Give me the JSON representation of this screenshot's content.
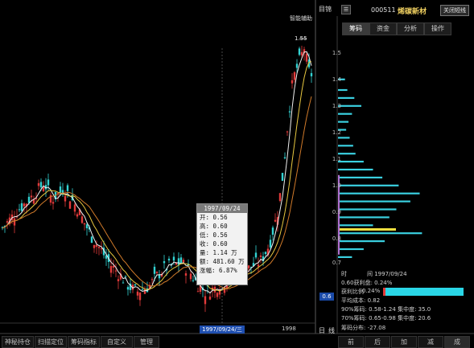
{
  "header": {
    "code": "000511",
    "name": "烯碳新材",
    "settings_button": "关闭短线",
    "corner_label": "目锦",
    "assist_label": "智能辅助",
    "high_marker": "1.55"
  },
  "right_tabs": [
    {
      "label": "筹码",
      "active": true
    },
    {
      "label": "资金",
      "active": false
    },
    {
      "label": "分析",
      "active": false
    },
    {
      "label": "操作",
      "active": false
    }
  ],
  "price_axis": [
    "1.5",
    "1.4",
    "1.3",
    "1.2",
    "1.1",
    "1.0",
    "0.9",
    "0.8",
    "0.7"
  ],
  "current_price_badge": "0.6",
  "tooltip": {
    "date": "1997/09/24",
    "rows": [
      "开: 0.56",
      "高: 0.60",
      "低: 0.56",
      "收: 0.60",
      "量: 1.14 万",
      "额: 481.60 万",
      "涨幅: 6.87%"
    ]
  },
  "x_axis": {
    "cursor_date": "1997/09/24/三",
    "year_label": "1998"
  },
  "bottom_tabs": [
    "神秘持仓",
    "扫描定位",
    "筹码指标",
    "自定义",
    "管理"
  ],
  "bottom_right_labels": [
    "日",
    "线"
  ],
  "bottom_nav": [
    "前",
    "后",
    "加",
    "减",
    "成"
  ],
  "chip_info": {
    "date_row": [
      "时",
      "间 1997/09/24"
    ],
    "profit_row": "0.60获利盘: 0.24%",
    "profit_ratio_label": "获利比例",
    "profit_ratio_value": "0.24%",
    "avg_cost": "平均成本: 0.82",
    "chip90": "90%筹码: 0.58-1.24  集中度: 35.0",
    "chip70": "70%筹码: 0.65-0.98  集中度: 20.6",
    "chip_dist": "筹码分布: -27.08"
  },
  "colors": {
    "up": "#e23a3a",
    "down": "#33d2d2",
    "ma_short": "#f0f0f0",
    "ma_mid": "#e8c840",
    "ma_long": "#d07a2a",
    "chip_bar": "#3ad0e0",
    "chip_highlight": "#f0e040",
    "profit_bar": "#2ad6e6"
  }
}
